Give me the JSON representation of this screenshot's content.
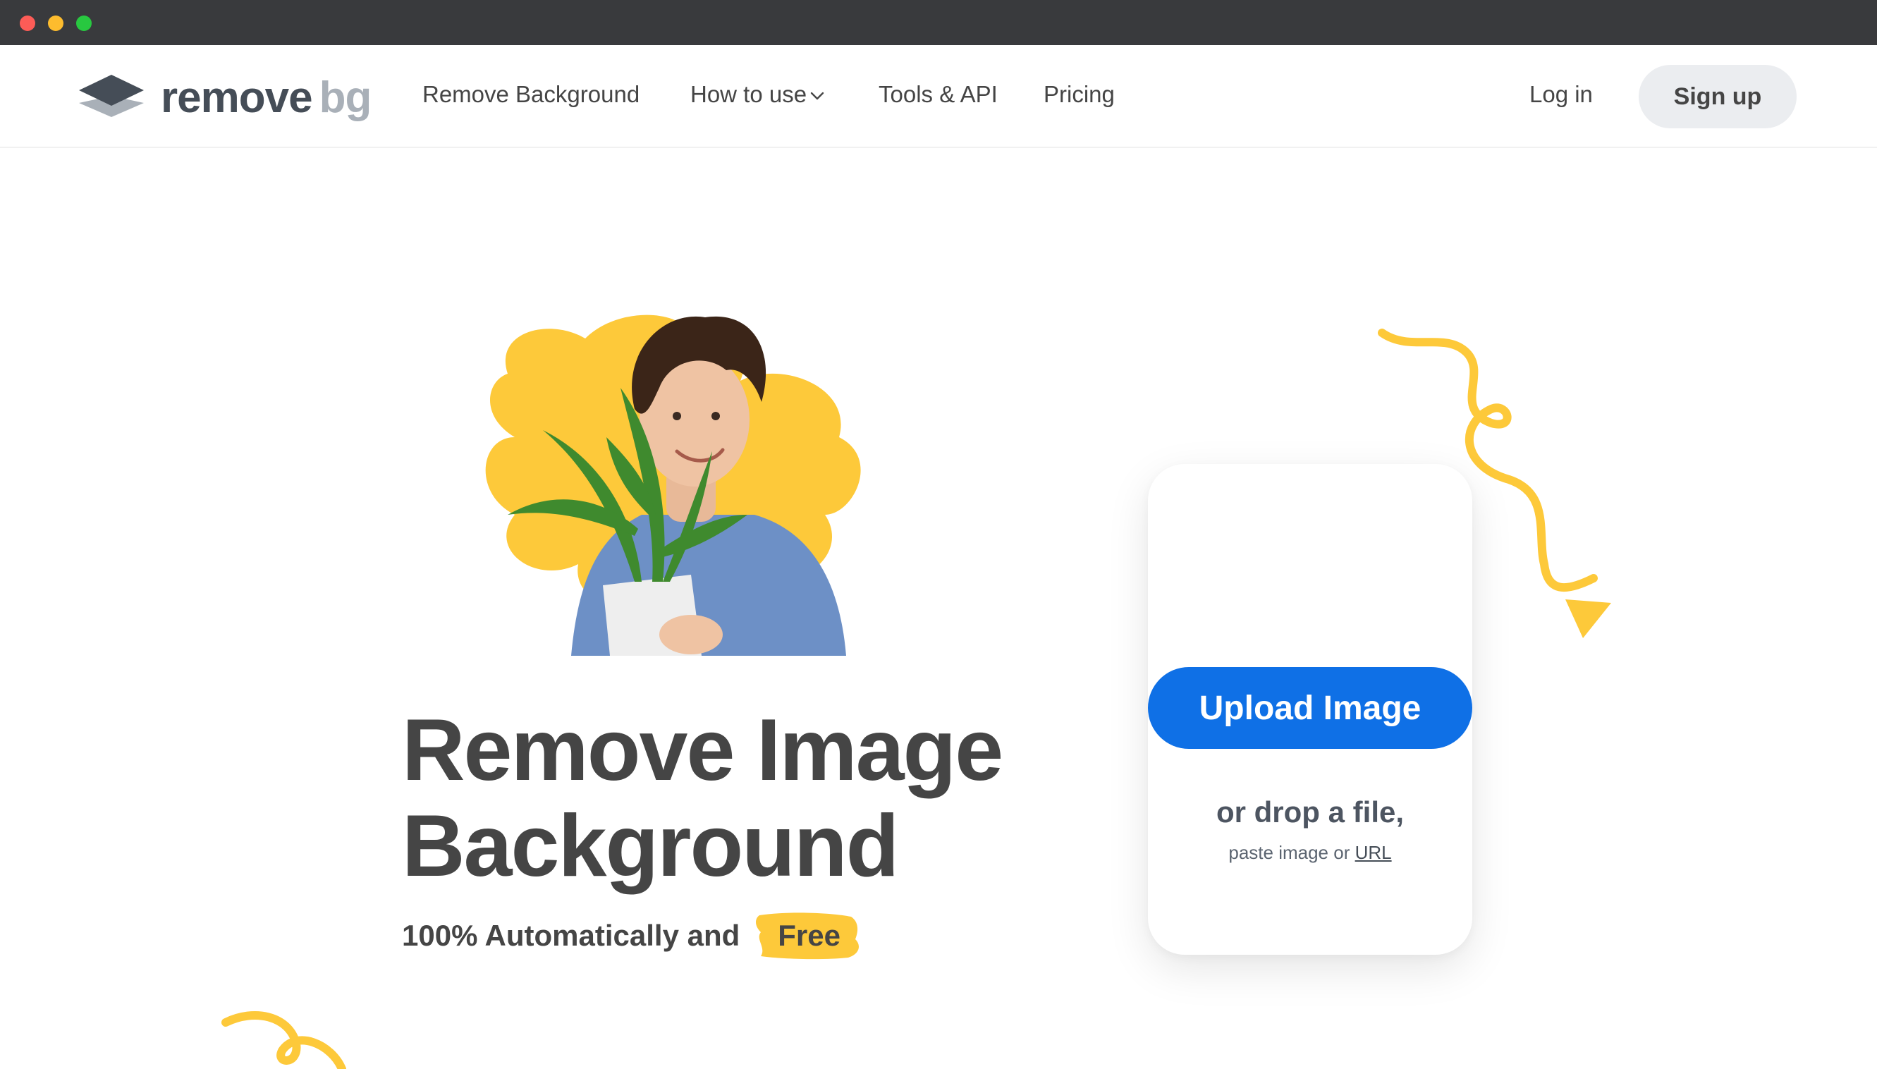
{
  "window": {
    "controls": [
      "close",
      "minimize",
      "maximize"
    ]
  },
  "logo": {
    "word_primary": "remove",
    "word_secondary": "bg",
    "icon": "layers-logo-icon"
  },
  "nav": {
    "links": [
      "Remove Background",
      "How to use",
      "Tools & API",
      "Pricing"
    ],
    "login": "Log in",
    "signup": "Sign up"
  },
  "hero": {
    "title_line1": "Remove Image",
    "title_line2": "Background",
    "subtitle": "100% Automatically and",
    "highlight": "Free"
  },
  "upload": {
    "button": "Upload Image",
    "drop": "or drop a file,",
    "paste_prefix": "paste image or",
    "paste_link": "URL"
  },
  "colors": {
    "accent": "#0f70e6",
    "yellow": "#fdc93a",
    "text": "#454545",
    "chrome": "#393a3d"
  }
}
